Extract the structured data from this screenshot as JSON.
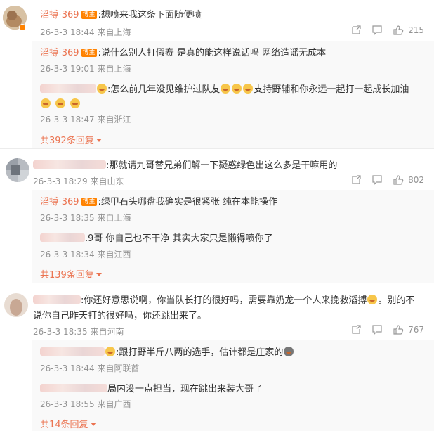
{
  "threads": [
    {
      "user": "滔搏-369",
      "badge": "博主",
      "text": ":想喷来我这条下面随便喷",
      "time": "26-3-3 18:44",
      "location": "来自上海",
      "likes": "215",
      "replies": [
        {
          "user": "滔搏-369",
          "badge": "博主",
          "text": ":说什么别人打假赛  是真的能这样说话吗  网络造谣无成本",
          "time": "26-3-3 19:01",
          "location": "来自上海"
        },
        {
          "text": ":怎么前几年没见维护过队友",
          "text2": "支持野辅和你永远一起打一起成长加油",
          "time": "26-3-3 18:47",
          "location": "来自浙江"
        }
      ],
      "more": "共392条回复"
    },
    {
      "text": ":那就请九哥替兄弟们解一下疑惑绿色出这么多是干嘛用的",
      "time": "26-3-3 18:29",
      "location": "来自山东",
      "likes": "802",
      "replies": [
        {
          "user": "滔搏-369",
          "badge": "博主",
          "text": ":绿甲石头哪盘我确实是很紧张 纯在本能操作",
          "time": "26-3-3 18:35",
          "location": "来自上海"
        },
        {
          "text": ".9哥 你自己也不干净 其实大家只是懒得喷你了",
          "time": "26-3-3 18:34",
          "location": "来自江西"
        }
      ],
      "more": "共139条回复"
    },
    {
      "text": ":你还好意思说啊，你当队长打的很好吗，需要靠奶龙一个人来挽救滔搏",
      "text_b": "。别的不",
      "text_line2": "说你自己昨天打的很好吗，你还跳出来了。",
      "time": "26-3-3 18:35",
      "location": "来自河南",
      "likes": "767",
      "replies": [
        {
          "text": ":跟打野半斤八两的选手，估计都是庄家的",
          "time": "26-3-3 18:44",
          "location": "来自阿联酋"
        },
        {
          "text": "局内没一点担当，现在跳出来装大哥了",
          "time": "26-3-3 18:55",
          "location": "来自广西"
        }
      ],
      "more": "共14条回复"
    }
  ]
}
